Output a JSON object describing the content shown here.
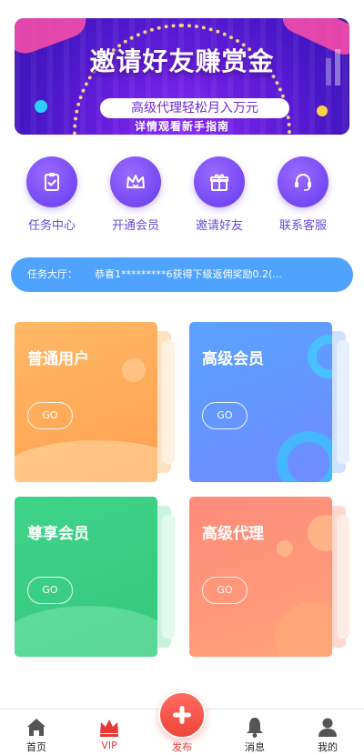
{
  "banner": {
    "title": "邀请好友赚赏金",
    "pill": "高级代理轻松月入万元",
    "subtitle": "详情观看新手指南"
  },
  "menu": [
    {
      "label": "任务中心",
      "icon": "task-clipboard-icon"
    },
    {
      "label": "开通会员",
      "icon": "crown-icon"
    },
    {
      "label": "邀请好友",
      "icon": "gift-icon"
    },
    {
      "label": "联系客服",
      "icon": "headset-icon"
    }
  ],
  "notice": {
    "label": "任务大厅：",
    "text": "恭喜1*********6获得下级返佣奖励0.2(..."
  },
  "cards": [
    {
      "title": "普通用户",
      "button": "GO"
    },
    {
      "title": "高级会员",
      "button": "GO"
    },
    {
      "title": "尊享会员",
      "button": "GO"
    },
    {
      "title": "高级代理",
      "button": "GO"
    }
  ],
  "tabbar": {
    "home": "首页",
    "vip": "VIP",
    "publish": "发布",
    "messages": "消息",
    "mine": "我的"
  },
  "colors": {
    "accent_purple": "#7a4df5",
    "notice_blue": "#4fa3ff",
    "tab_active": "#e53935"
  }
}
